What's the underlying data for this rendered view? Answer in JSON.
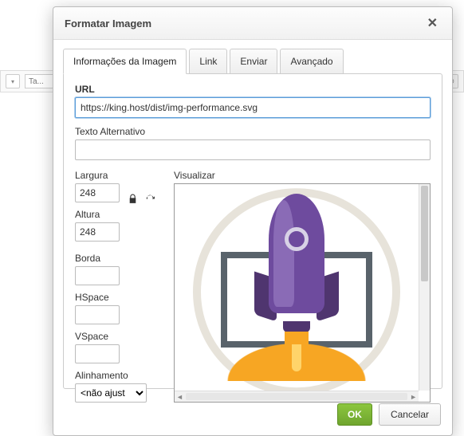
{
  "bg": {
    "placeholder": "Ta..."
  },
  "dialog": {
    "title": "Formatar Imagem",
    "tabs": {
      "info": "Informações da Imagem",
      "link": "Link",
      "upload": "Enviar",
      "advanced": "Avançado"
    },
    "fields": {
      "url_label": "URL",
      "url_value": "https://king.host/dist/img-performance.svg",
      "alt_label": "Texto Alternativo",
      "alt_value": "",
      "width_label": "Largura",
      "width_value": "248",
      "height_label": "Altura",
      "height_value": "248",
      "border_label": "Borda",
      "border_value": "",
      "hspace_label": "HSpace",
      "hspace_value": "",
      "vspace_label": "VSpace",
      "vspace_value": "",
      "align_label": "Alinhamento",
      "align_value": "<não ajust",
      "preview_label": "Visualizar"
    },
    "buttons": {
      "ok": "OK",
      "cancel": "Cancelar"
    },
    "icons": {
      "lock": "lock-icon",
      "reset": "refresh-icon",
      "close": "close-icon"
    }
  }
}
